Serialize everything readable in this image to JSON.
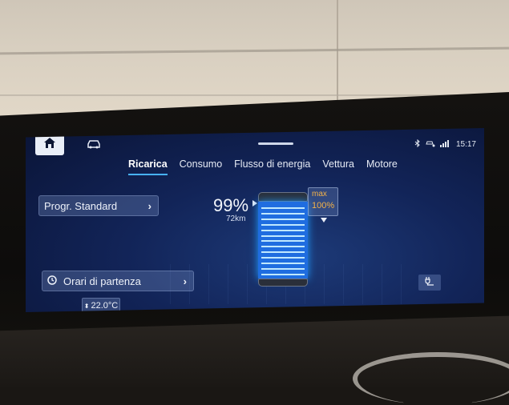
{
  "header": {
    "home_icon": "home-icon",
    "vehicle_icon": "car-icon",
    "status": {
      "bluetooth_icon": "bluetooth-icon",
      "connected_icon": "connected-car-icon",
      "signal_icon": "signal-bars-icon",
      "time": "15:17"
    }
  },
  "tabs": [
    {
      "label": "Ricarica",
      "active": true
    },
    {
      "label": "Consumo",
      "active": false
    },
    {
      "label": "Flusso di energia",
      "active": false
    },
    {
      "label": "Vettura",
      "active": false
    },
    {
      "label": "Motore",
      "active": false
    }
  ],
  "charging": {
    "program_label": "Progr. Standard",
    "soc": "99%",
    "range": "72km",
    "max_label": "max",
    "max_value": "100%",
    "departure_label": "Orari di partenza",
    "temperature": "22.0°C",
    "battery_fill_fraction": 0.99
  },
  "colors": {
    "accent": "#47b2ff",
    "max_text": "#f2b24a",
    "battery": "#1f6de0"
  }
}
